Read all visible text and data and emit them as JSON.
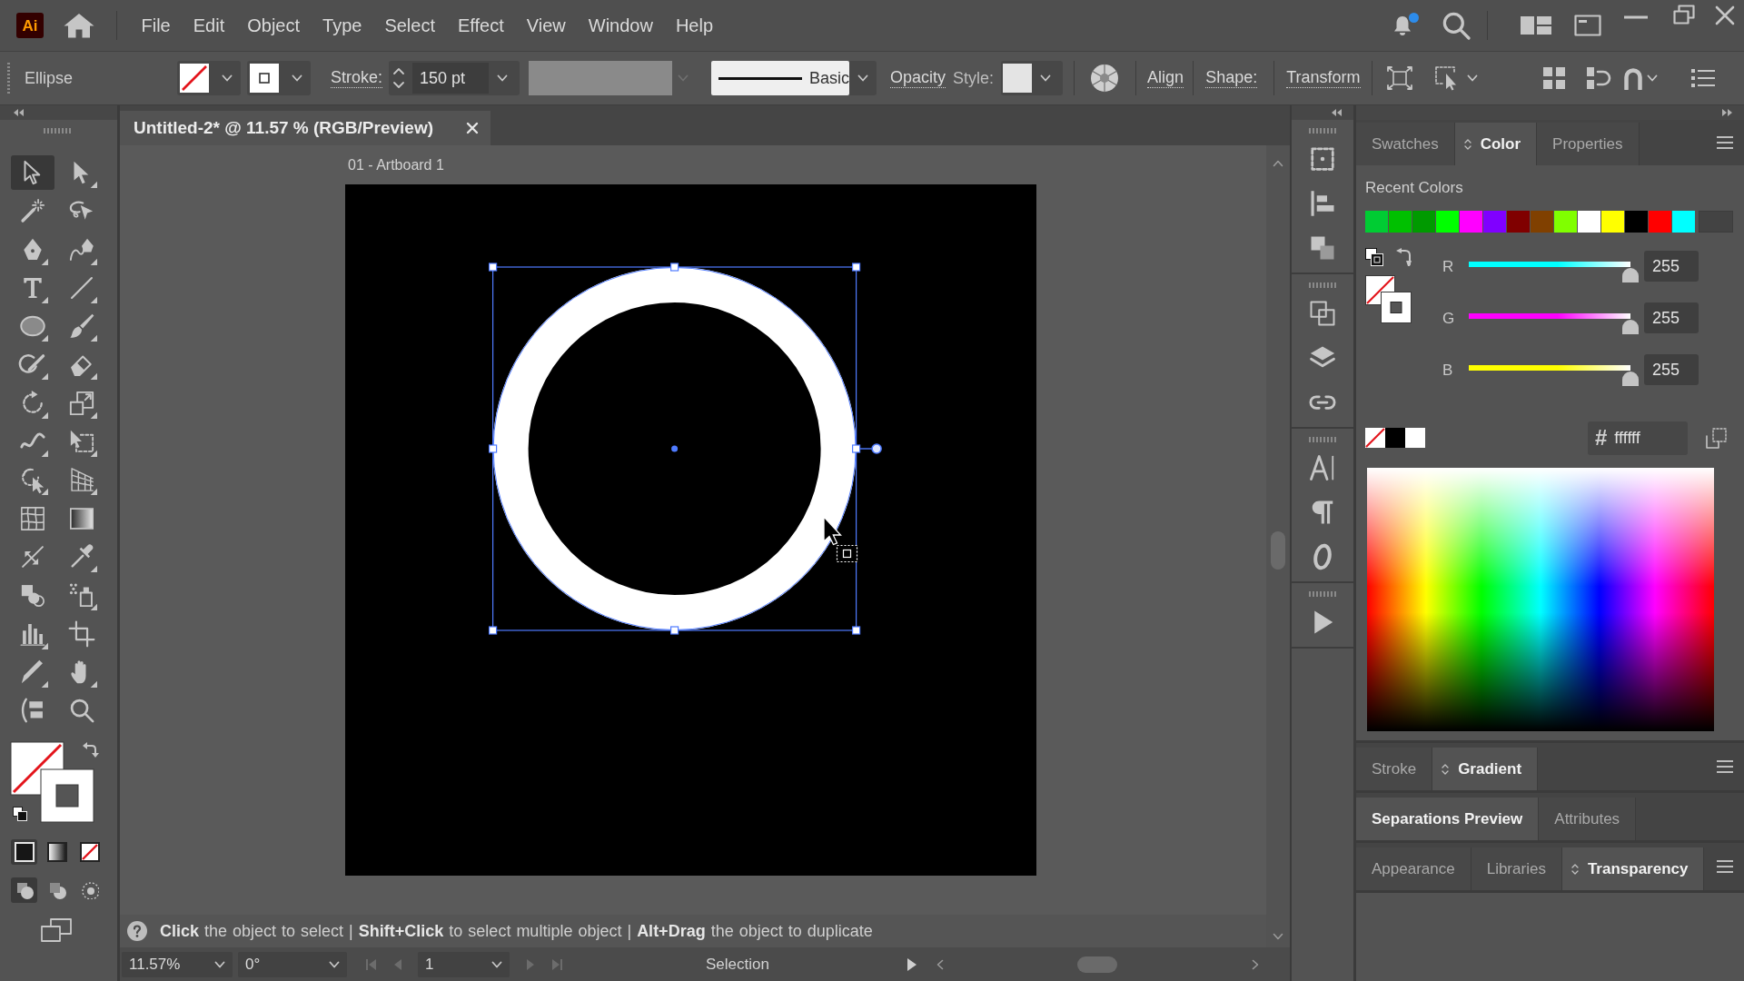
{
  "app": {
    "logo": "Ai",
    "notifications": true
  },
  "menu": [
    {
      "label": "File"
    },
    {
      "label": "Edit"
    },
    {
      "label": "Object"
    },
    {
      "label": "Type"
    },
    {
      "label": "Select"
    },
    {
      "label": "Effect"
    },
    {
      "label": "View"
    },
    {
      "label": "Window"
    },
    {
      "label": "Help"
    }
  ],
  "control_bar": {
    "object_type": "Ellipse",
    "stroke_label": "Stroke:",
    "stroke_weight": "150 pt",
    "profile_disabled": true,
    "brush": "Basic",
    "opacity_label": "Opacity",
    "style_label": "Style:",
    "panel_links": [
      {
        "label": "Align"
      },
      {
        "label": "Shape:"
      },
      {
        "label": "Transform"
      }
    ]
  },
  "toolbar": {
    "tools": [
      {
        "kind": "selection",
        "selected": true,
        "flyout": false
      },
      {
        "kind": "direct_selection",
        "selected": false,
        "flyout": true
      },
      {
        "kind": "magic_wand",
        "selected": false,
        "flyout": false
      },
      {
        "kind": "lasso",
        "selected": false,
        "flyout": false
      },
      {
        "kind": "pen",
        "selected": false,
        "flyout": true
      },
      {
        "kind": "curvature",
        "selected": false,
        "flyout": true
      },
      {
        "kind": "type",
        "selected": false,
        "flyout": true
      },
      {
        "kind": "line",
        "selected": false,
        "flyout": true
      },
      {
        "kind": "ellipse",
        "selected": false,
        "flyout": true
      },
      {
        "kind": "paintbrush",
        "selected": false,
        "flyout": true
      },
      {
        "kind": "shaper",
        "selected": false,
        "flyout": true
      },
      {
        "kind": "eraser",
        "selected": false,
        "flyout": true
      },
      {
        "kind": "rotate",
        "selected": false,
        "flyout": true
      },
      {
        "kind": "scale",
        "selected": false,
        "flyout": true
      },
      {
        "kind": "warp",
        "selected": false,
        "flyout": true
      },
      {
        "kind": "free_transform",
        "selected": false,
        "flyout": true
      },
      {
        "kind": "shape_builder",
        "selected": false,
        "flyout": true
      },
      {
        "kind": "perspective_grid",
        "selected": false,
        "flyout": true
      },
      {
        "kind": "mesh",
        "selected": false,
        "flyout": false
      },
      {
        "kind": "gradient",
        "selected": false,
        "flyout": false
      },
      {
        "kind": "width",
        "selected": false,
        "flyout": false
      },
      {
        "kind": "eyedropper",
        "selected": false,
        "flyout": true
      },
      {
        "kind": "blend",
        "selected": false,
        "flyout": false
      },
      {
        "kind": "symbol_sprayer",
        "selected": false,
        "flyout": true
      },
      {
        "kind": "graph",
        "selected": false,
        "flyout": true
      },
      {
        "kind": "artboard",
        "selected": false,
        "flyout": false
      },
      {
        "kind": "knife",
        "selected": false,
        "flyout": true
      },
      {
        "kind": "hand",
        "selected": false,
        "flyout": true
      },
      {
        "kind": "print_tiling",
        "selected": false,
        "flyout": false
      },
      {
        "kind": "zoom",
        "selected": false,
        "flyout": false
      }
    ],
    "color_modes": [
      {
        "kind": "color",
        "selected": true
      },
      {
        "kind": "gradient",
        "selected": false
      },
      {
        "kind": "none",
        "selected": false
      }
    ],
    "draw_modes": [
      {
        "kind": "normal",
        "selected": true
      },
      {
        "kind": "behind",
        "selected": false
      },
      {
        "kind": "inside",
        "selected": false
      }
    ]
  },
  "document": {
    "tab_title": "Untitled-2* @ 11.57 % (RGB/Preview)",
    "artboard_label": "01 - Artboard 1",
    "objects": [
      {
        "kind": "ring",
        "selected": true
      }
    ]
  },
  "hint_bar": {
    "text": "**Click** the object to select | **Shift+Click** to select multiple object | **Alt+Drag** the object to duplicate"
  },
  "status_bar": {
    "zoom": "11.57%",
    "rotation": "0°",
    "artboard": "1",
    "artboard_nav": [
      {
        "kind": "first",
        "disabled": true
      },
      {
        "kind": "previous",
        "disabled": true
      },
      {
        "kind": "next",
        "disabled": true
      },
      {
        "kind": "last",
        "disabled": true
      }
    ],
    "current_tool": "Selection"
  },
  "color_panel": {
    "tabs": [
      {
        "label": "Swatches",
        "selected": false,
        "options_toggle": false
      },
      {
        "label": "Color",
        "selected": true,
        "options_toggle": true
      },
      {
        "label": "Properties",
        "selected": false,
        "options_toggle": false
      }
    ],
    "menu": true,
    "recent_label": "Recent Colors",
    "recent_colors": [
      {
        "color": "#00cc33"
      },
      {
        "color": "#00c000"
      },
      {
        "color": "#009a00"
      },
      {
        "color": "#00ff00"
      },
      {
        "color": "#ff00ff"
      },
      {
        "color": "#8000ff"
      },
      {
        "color": "#800000"
      },
      {
        "color": "#804000"
      },
      {
        "color": "#80ff00"
      },
      {
        "color": "#ffffff"
      },
      {
        "color": "#ffff00"
      },
      {
        "color": "#000000"
      },
      {
        "color": "#ff0000"
      },
      {
        "color": "#00ffff"
      }
    ],
    "channels": [
      {
        "name": "R",
        "value": "255",
        "level": 1,
        "color": "#00ffff"
      },
      {
        "name": "G",
        "value": "255",
        "level": 1,
        "color": "#ff00ff"
      },
      {
        "name": "B",
        "value": "255",
        "level": 1,
        "color": "#ffff00"
      }
    ],
    "quick_swatches": [
      {
        "kind": "none"
      },
      {
        "kind": "swatch",
        "color": "#000000"
      },
      {
        "kind": "swatch",
        "color": "#ffffff"
      }
    ],
    "hex_label": "#",
    "hex_value": "ffffff"
  },
  "panel_groups": [
    {
      "menu": true,
      "tabs": [
        {
          "label": "Stroke",
          "selected": false,
          "options_toggle": false
        },
        {
          "label": "Gradient",
          "selected": true,
          "options_toggle": true
        }
      ]
    },
    {
      "menu": false,
      "tabs": [
        {
          "label": "Separations Preview",
          "selected": true,
          "options_toggle": false
        },
        {
          "label": "Attributes",
          "selected": false,
          "options_toggle": false
        }
      ]
    },
    {
      "menu": true,
      "tabs": [
        {
          "label": "Appearance",
          "selected": false,
          "options_toggle": false
        },
        {
          "label": "Libraries",
          "selected": false,
          "options_toggle": false
        },
        {
          "label": "Transparency",
          "selected": true,
          "options_toggle": true
        }
      ]
    }
  ]
}
